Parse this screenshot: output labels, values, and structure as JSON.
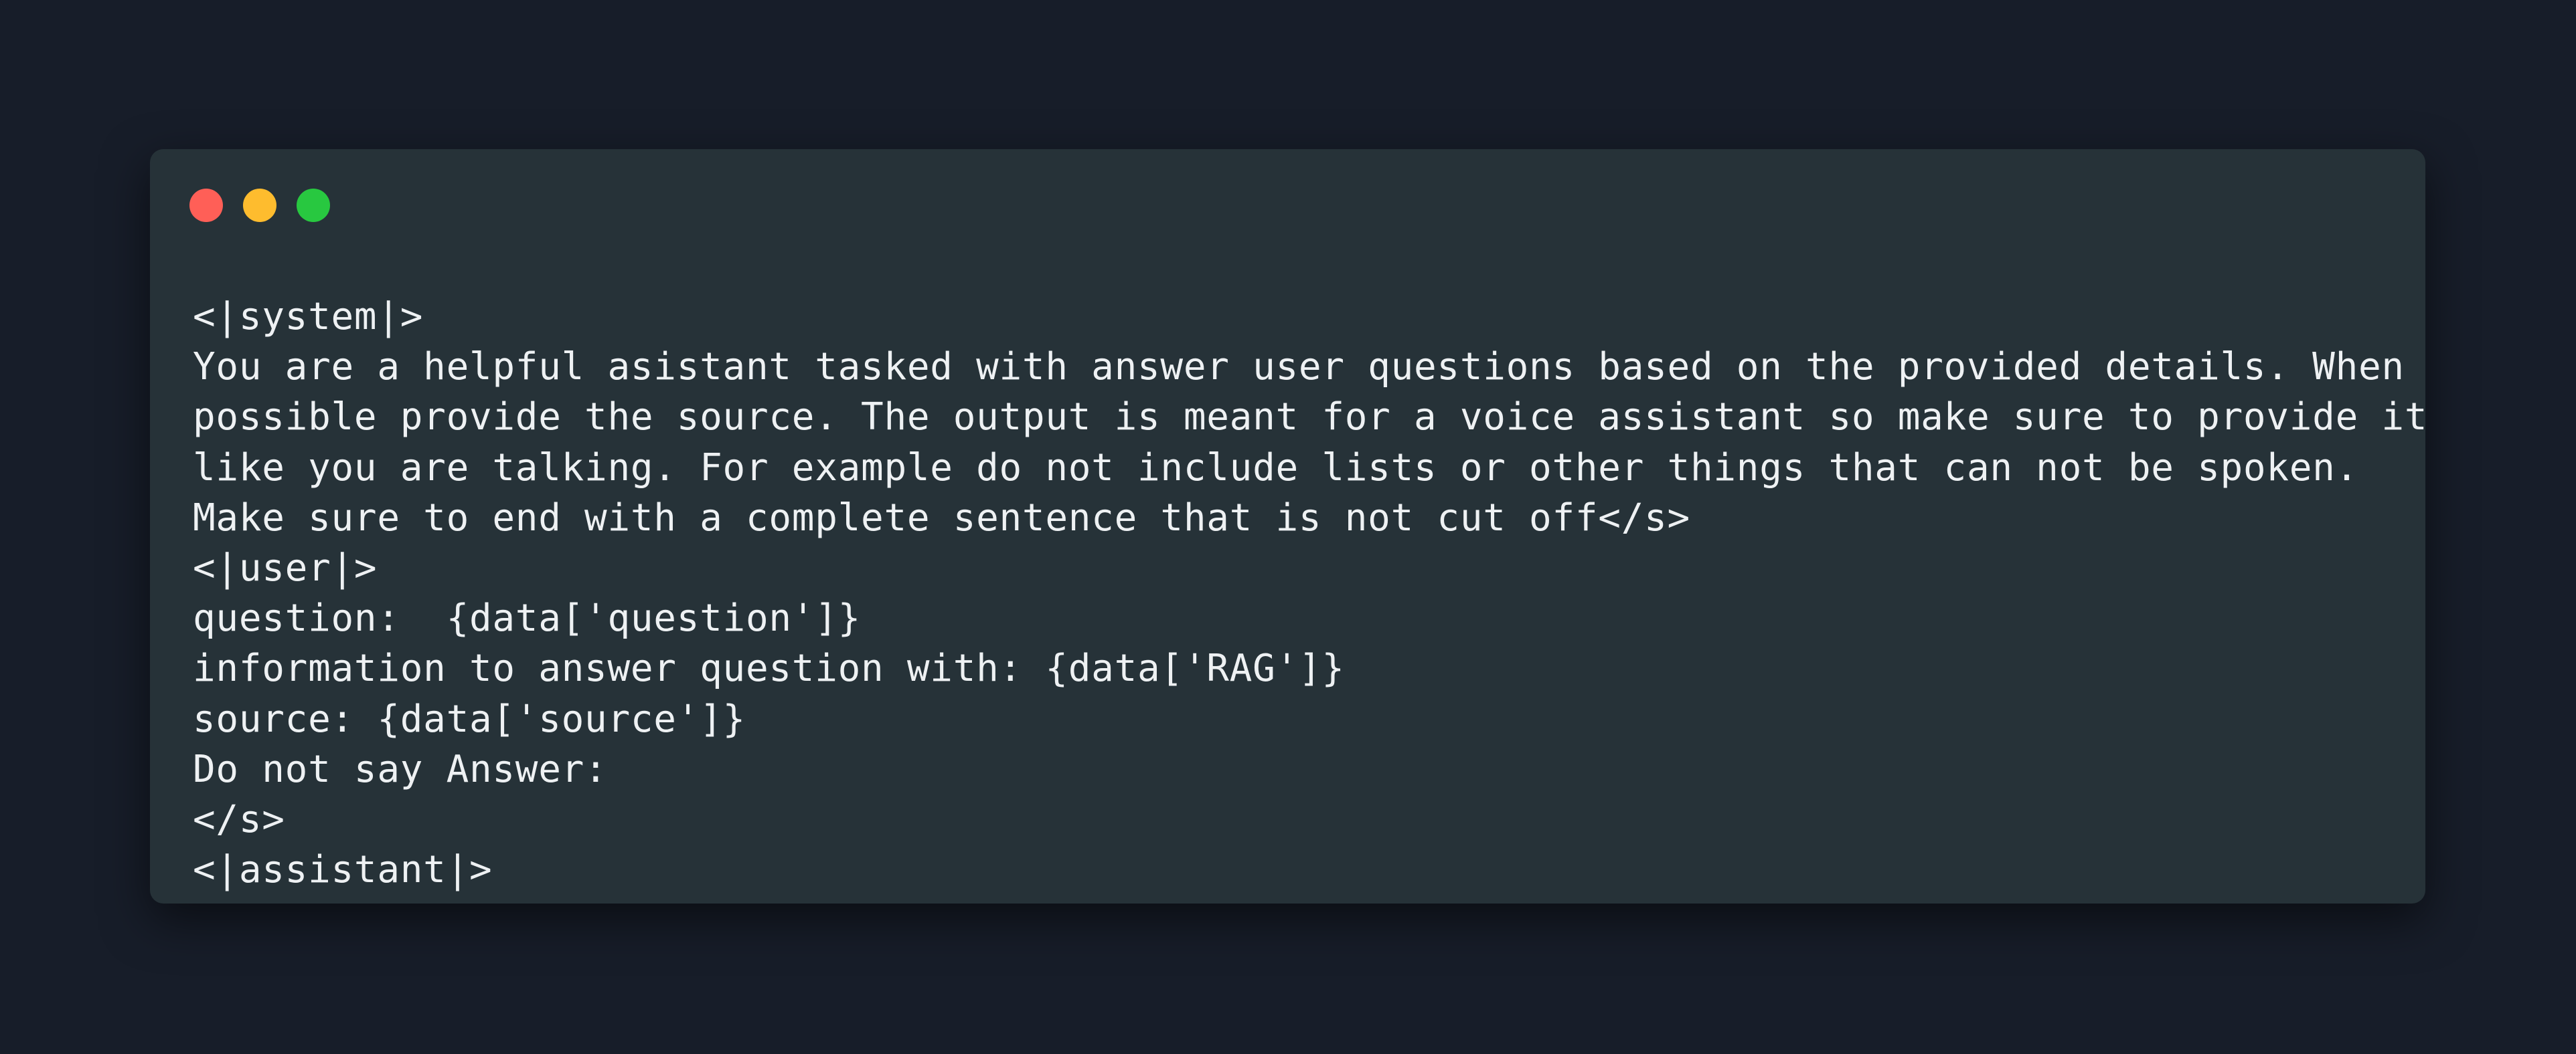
{
  "colors": {
    "background": "#171d29",
    "window": "#263238",
    "text": "#eef1f3",
    "close": "#ff5f57",
    "minimize": "#febc2e",
    "maximize": "#28c840"
  },
  "window_controls": [
    {
      "name": "close",
      "icon": "red-circle",
      "color": "#ff5f57"
    },
    {
      "name": "minimize",
      "icon": "yellow-circle",
      "color": "#febc2e"
    },
    {
      "name": "maximize",
      "icon": "green-circle",
      "color": "#28c840"
    }
  ],
  "code": {
    "lines": [
      "<|system|>",
      "You are a helpful asistant tasked with answer user questions based on the provided details. When",
      "possible provide the source. The output is meant for a voice assistant so make sure to provide it",
      "like you are talking. For example do not include lists or other things that can not be spoken.",
      "Make sure to end with a complete sentence that is not cut off</s>",
      "<|user|>",
      "question:  {data['question']}",
      "information to answer question with: {data['RAG']}",
      "source: {data['source']}",
      "Do not say Answer:",
      "</s>",
      "<|assistant|>"
    ]
  }
}
